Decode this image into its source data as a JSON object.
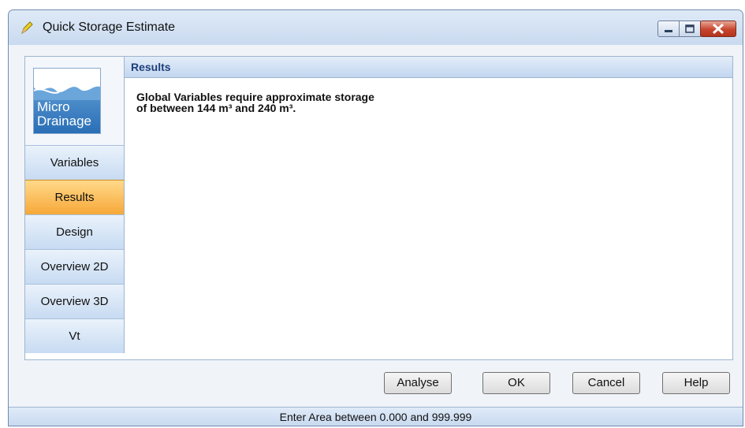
{
  "window": {
    "title": "Quick Storage Estimate",
    "title_icon": "pencil-icon",
    "controls": {
      "minimize": "minimize-icon",
      "maximize": "maximize-icon",
      "close": "close-icon"
    }
  },
  "logo": {
    "lines": [
      "Micro",
      "Drainage"
    ]
  },
  "nav": {
    "items": [
      {
        "label": "Variables",
        "active": false
      },
      {
        "label": "Results",
        "active": true
      },
      {
        "label": "Design",
        "active": false
      },
      {
        "label": "Overview 2D",
        "active": false
      },
      {
        "label": "Overview 3D",
        "active": false
      },
      {
        "label": "Vt",
        "active": false
      }
    ]
  },
  "panel": {
    "header": "Results",
    "lines": [
      "Global Variables require approximate storage",
      "of between 144 m³ and 240 m³."
    ]
  },
  "buttons": {
    "analyse": "Analyse",
    "ok": "OK",
    "cancel": "Cancel",
    "help": "Help"
  },
  "status": "Enter Area between 0.000 and 999.999",
  "colors": {
    "accent_active": "#f7a838",
    "frame": "#d6e3f3",
    "header_text": "#1e3f7a"
  }
}
